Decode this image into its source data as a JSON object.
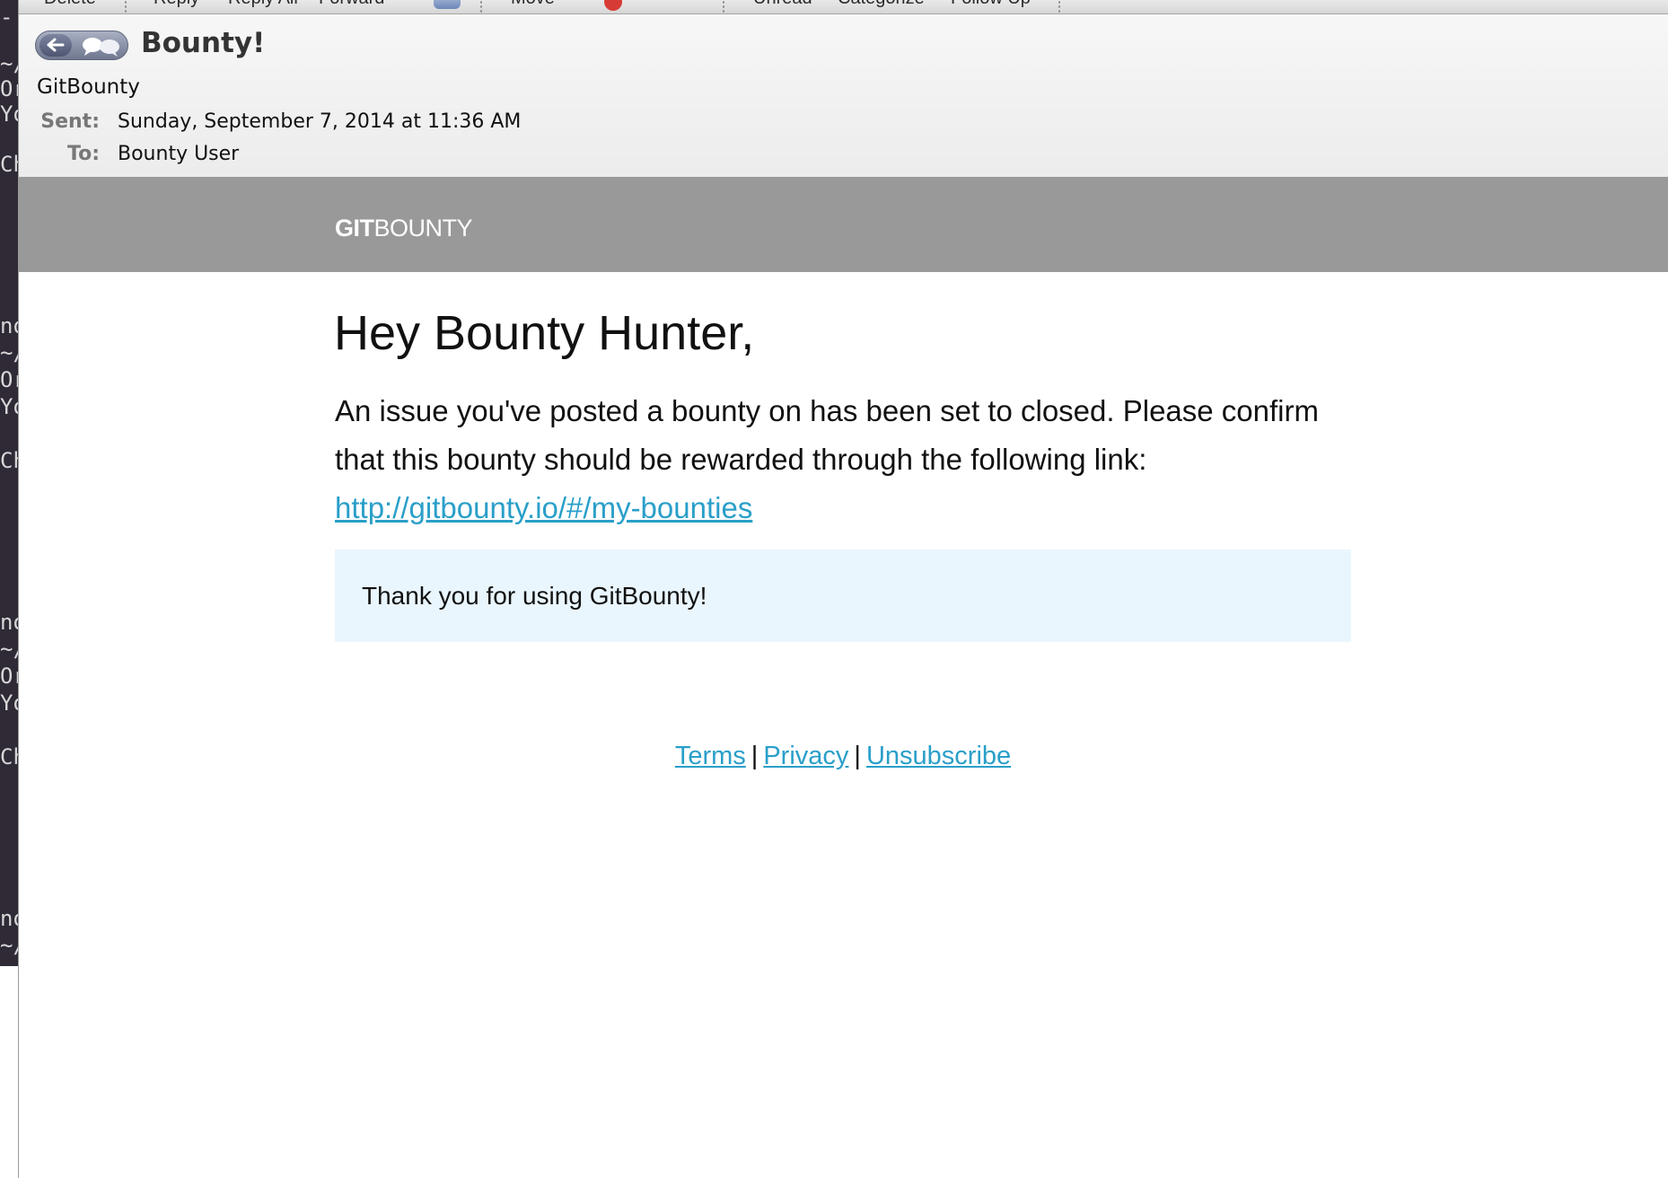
{
  "toolbar": {
    "items": [
      "Delete",
      "Reply",
      "Reply All",
      "Forward",
      "Move",
      "Unread",
      "Categorize",
      "Follow Up"
    ]
  },
  "terminal": {
    "lines": [
      "-",
      "~/",
      "Or",
      "Yo",
      "Ch",
      "no",
      "~/",
      "Or",
      "Yo",
      "Ch",
      "no",
      "~/",
      "Or",
      "Yo",
      "Ch",
      "no",
      "~/"
    ]
  },
  "message": {
    "subject": "Bounty!",
    "sender": "GitBounty",
    "sent_label": "Sent:",
    "sent_value": "Sunday, September 7, 2014 at 11:36 AM",
    "to_label": "To:",
    "to_value": "Bounty User"
  },
  "email": {
    "brand_bold": "GIT",
    "brand_light": "BOUNTY",
    "greeting": "Hey Bounty Hunter,",
    "body": "An issue you've posted a bounty on has been set to closed. Please confirm that this bounty should be rewarded through the following link:",
    "link": "http://gitbounty.io/#/my-bounties",
    "callout": "Thank you for using GitBounty!",
    "footer": {
      "terms": "Terms",
      "privacy": "Privacy",
      "unsubscribe": "Unsubscribe",
      "separator": "|"
    }
  },
  "colors": {
    "banner": "#999999",
    "link": "#2a9fc9",
    "callout_bg": "#eaf6fd"
  }
}
